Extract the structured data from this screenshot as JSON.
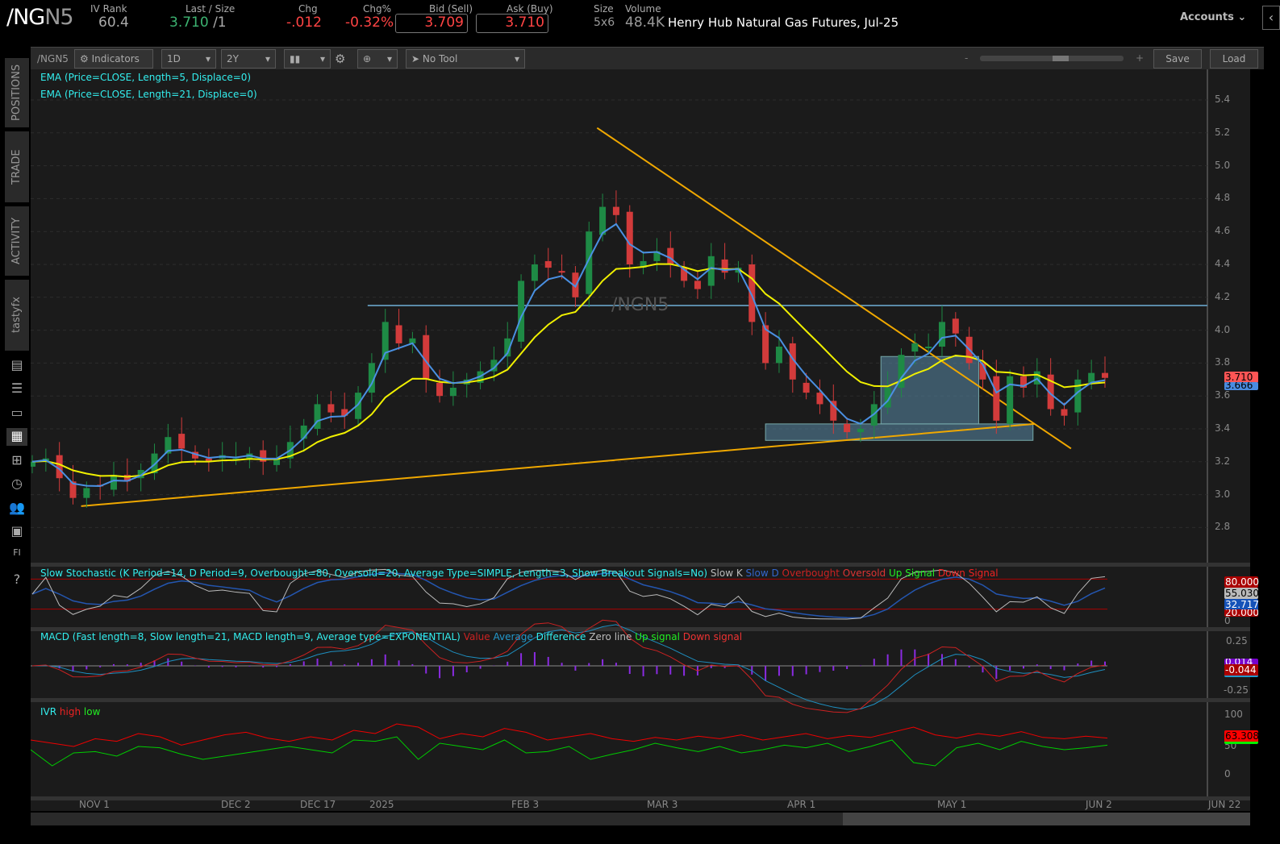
{
  "header": {
    "symbol_main": "/NG",
    "symbol_sub": "N5",
    "iv_rank_label": "IV Rank",
    "iv_rank": "60.4",
    "last_label": "Last / Size",
    "last": "3.710",
    "size": "/1",
    "chg_label": "Chg",
    "chg": "-.012",
    "chgp_label": "Chg%",
    "chgp": "-0.32%",
    "bid_label": "Bid (Sell)",
    "bid": "3.709",
    "ask_label": "Ask (Buy)",
    "ask": "3.710",
    "size_label": "Size",
    "size_val": "5x6",
    "volume_label": "Volume",
    "volume": "48.4K",
    "description": "Henry Hub Natural Gas Futures, Jul-25",
    "accounts": "Accounts"
  },
  "toolbar": {
    "symbol": "/NGN5",
    "indicators": "Indicators",
    "aggregation": "1D",
    "timeframe": "2Y",
    "tool": "No Tool",
    "zoom_minus": "-",
    "zoom_plus": "+",
    "save": "Save",
    "load": "Load",
    "zoom_level": 0.55
  },
  "sidebar": {
    "tabs": [
      "POSITIONS",
      "TRADE",
      "ACTIVITY",
      "tastyfx"
    ],
    "icons": [
      "chart-grid-icon",
      "list-icon",
      "tv-icon",
      "chart-icon",
      "layout-icon",
      "clock-icon",
      "people-icon",
      "calendar-icon",
      "fi-icon",
      "help-icon"
    ]
  },
  "colors": {
    "up": "#1e8a45",
    "down": "#d23b3b",
    "ema5": "#4a90e2",
    "ema21": "#f0f000",
    "trend": "#f0a800",
    "box": "#5a8aa8"
  },
  "chart_data": {
    "type": "candlestick",
    "title": "/NGN5 1D",
    "watermark": "/NGN5",
    "studies": [
      "EMA (Price=CLOSE, Length=5, Displace=0)",
      "EMA (Price=CLOSE, Length=21, Displace=0)"
    ],
    "ylim": [
      2.7,
      5.5
    ],
    "yticks": [
      "5.4",
      "5.2",
      "5.0",
      "4.8",
      "4.6",
      "4.4",
      "4.2",
      "4.0",
      "3.8",
      "3.6",
      "3.4",
      "3.2",
      "3.0",
      "2.8"
    ],
    "xticks": [
      "NOV 1",
      "DEC 2",
      "DEC 17",
      "2025",
      "FEB 3",
      "MAR 3",
      "APR 1",
      "MAY 1",
      "JUN 2",
      "JUN 22"
    ],
    "close": [
      3.2,
      3.22,
      3.1,
      2.98,
      3.04,
      3.05,
      3.12,
      3.08,
      3.15,
      3.25,
      3.35,
      3.28,
      3.22,
      3.2,
      3.24,
      3.22,
      3.25,
      3.2,
      3.22,
      3.32,
      3.42,
      3.55,
      3.5,
      3.48,
      3.62,
      3.8,
      4.05,
      3.92,
      3.95,
      3.7,
      3.6,
      3.65,
      3.7,
      3.75,
      3.82,
      3.95,
      4.3,
      4.4,
      4.38,
      4.35,
      4.2,
      4.6,
      4.75,
      4.7,
      4.4,
      4.42,
      4.48,
      4.4,
      4.3,
      4.25,
      4.45,
      4.35,
      4.38,
      4.05,
      3.8,
      3.9,
      3.7,
      3.62,
      3.55,
      3.45,
      3.38,
      3.4,
      3.55,
      3.65,
      3.85,
      3.92,
      3.9,
      4.05,
      3.98,
      3.8,
      3.7,
      3.45,
      3.72,
      3.65,
      3.75,
      3.52,
      3.48,
      3.7,
      3.74,
      3.71
    ],
    "last_price": "3.710",
    "ema5_last": "3.666",
    "trendlines": [
      {
        "from": [
          41.6,
          5.23
        ],
        "to": [
          76.5,
          3.28
        ]
      },
      {
        "from": [
          3.6,
          2.93
        ],
        "to": [
          73.8,
          3.43
        ]
      }
    ],
    "hline": {
      "from": 24.7,
      "price": 4.15
    },
    "boxes": [
      {
        "from": 54,
        "to": 73.7,
        "top": 3.43,
        "bottom": 3.33
      },
      {
        "from": 62.5,
        "to": 69.7,
        "top": 3.84,
        "bottom": 3.43
      }
    ],
    "stochastic": {
      "label": "Slow Stochastic (K Period=14, D Period=9, Overbought=80, Oversold=20, Average Type=SIMPLE, Length=3, Show Breakout Signals=No)",
      "legend": [
        "Slow K",
        "Slow D",
        "Overbought",
        "Oversold",
        "Up Signal",
        "Down Signal"
      ],
      "overbought": "80.000",
      "slowk_last": "55.030",
      "slowd_last": "32.717",
      "oversold": "20.000",
      "zero": "0"
    },
    "macd": {
      "label": "MACD (Fast length=8, Slow length=21, MACD length=9, Average type=EXPONENTIAL)",
      "legend": [
        "Value",
        "Average",
        "Difference",
        "Zero line",
        "Up signal",
        "Down signal"
      ],
      "ticks": [
        "0.25",
        "-0.25"
      ],
      "diff_last": "0.014",
      "value_last": "-0.044"
    },
    "ivr": {
      "label": "IVR",
      "legend": [
        "high",
        "low"
      ],
      "ticks": [
        "100",
        "50",
        "0"
      ],
      "last": "63.308",
      "high": [
        60,
        55,
        50,
        62,
        58,
        70,
        65,
        52,
        60,
        68,
        72,
        63,
        58,
        65,
        60,
        75,
        70,
        85,
        80,
        62,
        70,
        65,
        78,
        72,
        60,
        65,
        70,
        62,
        58,
        64,
        60,
        66,
        62,
        68,
        60,
        65,
        70,
        62,
        67,
        64,
        72,
        80,
        68,
        63,
        70,
        66,
        73,
        64,
        62,
        66,
        63
      ],
      "low": [
        45,
        20,
        40,
        42,
        35,
        50,
        48,
        38,
        30,
        35,
        40,
        45,
        50,
        45,
        40,
        60,
        58,
        65,
        30,
        55,
        50,
        45,
        60,
        40,
        42,
        50,
        30,
        38,
        45,
        55,
        48,
        42,
        50,
        40,
        45,
        52,
        48,
        55,
        42,
        50,
        60,
        25,
        20,
        48,
        55,
        45,
        58,
        50,
        45,
        48,
        52
      ]
    }
  }
}
